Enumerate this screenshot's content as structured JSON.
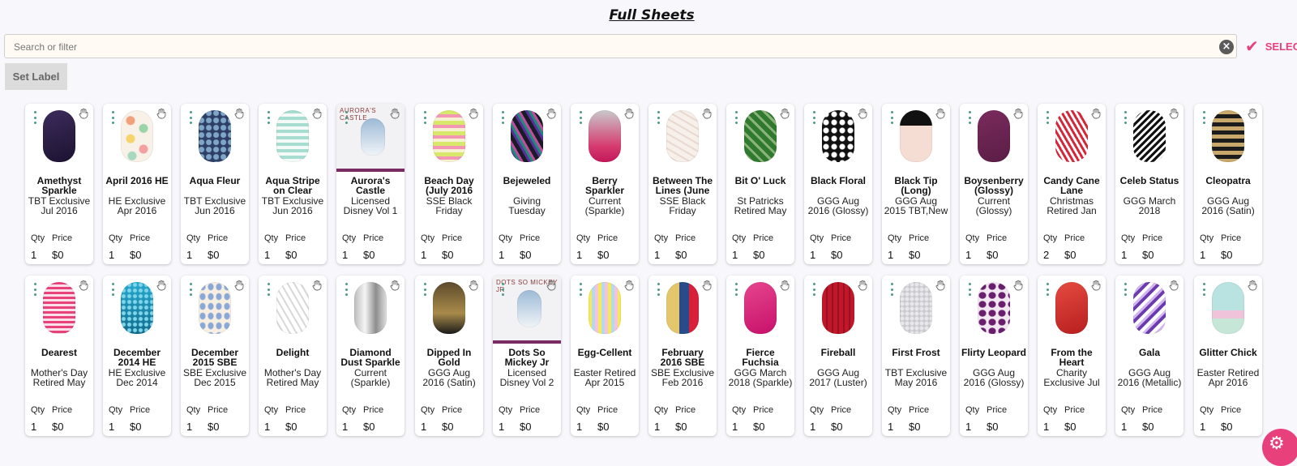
{
  "page": {
    "title": "Full Sheets"
  },
  "search": {
    "placeholder": "Search or filter",
    "value": ""
  },
  "select": {
    "label": "SELECT"
  },
  "set_label": {
    "label": "Set Label"
  },
  "card_labels": {
    "qty": "Qty",
    "price": "Price"
  },
  "rows": [
    [
      {
        "name": "Amethyst Sparkle",
        "sub": "TBT Exclusive Jul 2016",
        "qty": "1",
        "price": "$0",
        "design": "amethyst"
      },
      {
        "name": "April 2016 HE",
        "sub": "HE Exclusive Apr 2016",
        "qty": "1",
        "price": "$0",
        "design": "dots"
      },
      {
        "name": "Aqua Fleur",
        "sub": "TBT Exclusive Jun 2016",
        "qty": "1",
        "price": "$0",
        "design": "aquafleur"
      },
      {
        "name": "Aqua Stripe on Clear",
        "sub": "TBT Exclusive Jun 2016",
        "qty": "1",
        "price": "$0",
        "design": "aquastripe"
      },
      {
        "name": "Aurora's Castle",
        "sub": "Licensed Disney Vol 1",
        "qty": "1",
        "price": "$0",
        "design": "sheet",
        "sheet_title": "AURORA'S CASTLE"
      },
      {
        "name": "Beach Day (July 2016",
        "sub": "SSE Black Friday",
        "qty": "1",
        "price": "$0",
        "design": "beach"
      },
      {
        "name": "Bejeweled",
        "sub": "Giving Tuesday",
        "qty": "1",
        "price": "$0",
        "design": "bejeweled"
      },
      {
        "name": "Berry Sparkler",
        "sub": "Current (Sparkle)",
        "qty": "1",
        "price": "$0",
        "design": "berry"
      },
      {
        "name": "Between The Lines (June",
        "sub": "SSE Black Friday",
        "qty": "1",
        "price": "$0",
        "design": "lines"
      },
      {
        "name": "Bit O' Luck",
        "sub": "St Patricks Retired May",
        "qty": "1",
        "price": "$0",
        "design": "luck"
      },
      {
        "name": "Black Floral",
        "sub": "GGG Aug 2016 (Glossy)",
        "qty": "1",
        "price": "$0",
        "design": "blackfloral"
      },
      {
        "name": "Black Tip (Long)",
        "sub": "GGG Aug 2015 TBT,New",
        "qty": "1",
        "price": "$0",
        "design": "blacktip"
      },
      {
        "name": "Boysenberry (Glossy)",
        "sub": "Current (Glossy)",
        "qty": "1",
        "price": "$0",
        "design": "boysenberry"
      },
      {
        "name": "Candy Cane Lane",
        "sub": "Christmas Retired Jan",
        "qty": "2",
        "price": "$0",
        "design": "candycane"
      },
      {
        "name": "Celeb Status",
        "sub": "GGG March 2018",
        "qty": "1",
        "price": "$0",
        "design": "celeb"
      },
      {
        "name": "Cleopatra",
        "sub": "GGG Aug 2016 (Satin)",
        "qty": "1",
        "price": "$0",
        "design": "cleopatra"
      }
    ],
    [
      {
        "name": "Dearest",
        "sub": "Mother's Day Retired May",
        "qty": "1",
        "price": "$0",
        "design": "dearest"
      },
      {
        "name": "December 2014 HE",
        "sub": "HE Exclusive Dec 2014",
        "qty": "1",
        "price": "$0",
        "design": "dec2014"
      },
      {
        "name": "December 2015 SBE",
        "sub": "SBE Exclusive Dec 2015",
        "qty": "1",
        "price": "$0",
        "design": "dec2015"
      },
      {
        "name": "Delight",
        "sub": "Mother's Day Retired May",
        "qty": "1",
        "price": "$0",
        "design": "delight"
      },
      {
        "name": "Diamond Dust Sparkle",
        "sub": "Current (Sparkle)",
        "qty": "1",
        "price": "$0",
        "design": "diamond"
      },
      {
        "name": "Dipped In Gold",
        "sub": "GGG Aug 2016 (Satin)",
        "qty": "1",
        "price": "$0",
        "design": "dipped"
      },
      {
        "name": "Dots So Mickey Jr",
        "sub": "Licensed Disney Vol 2",
        "qty": "1",
        "price": "$0",
        "design": "sheet",
        "sheet_title": "DOTS SO MICKEY JR"
      },
      {
        "name": "Egg-Cellent",
        "sub": "Easter Retired Apr 2015",
        "qty": "1",
        "price": "$0",
        "design": "egg"
      },
      {
        "name": "February 2016 SBE",
        "sub": "SBE Exclusive Feb 2016",
        "qty": "1",
        "price": "$0",
        "design": "feb2016"
      },
      {
        "name": "Fierce Fuchsia",
        "sub": "GGG March 2018 (Sparkle)",
        "qty": "1",
        "price": "$0",
        "design": "fuchsia"
      },
      {
        "name": "Fireball",
        "sub": "GGG Aug 2017 (Luster)",
        "qty": "1",
        "price": "$0",
        "design": "fireball"
      },
      {
        "name": "First Frost",
        "sub": "TBT Exclusive May 2016",
        "qty": "1",
        "price": "$0",
        "design": "frost"
      },
      {
        "name": "Flirty Leopard",
        "sub": "GGG Aug 2016 (Glossy)",
        "qty": "1",
        "price": "$0",
        "design": "leopard"
      },
      {
        "name": "From the Heart",
        "sub": "Charity Exclusive Jul",
        "qty": "1",
        "price": "$0",
        "design": "heart"
      },
      {
        "name": "Gala",
        "sub": "GGG Aug 2016 (Metallic)",
        "qty": "1",
        "price": "$0",
        "design": "gala"
      },
      {
        "name": "Glitter Chick",
        "sub": "Easter Retired Apr 2016",
        "qty": "1",
        "price": "$0",
        "design": "chick"
      }
    ]
  ]
}
